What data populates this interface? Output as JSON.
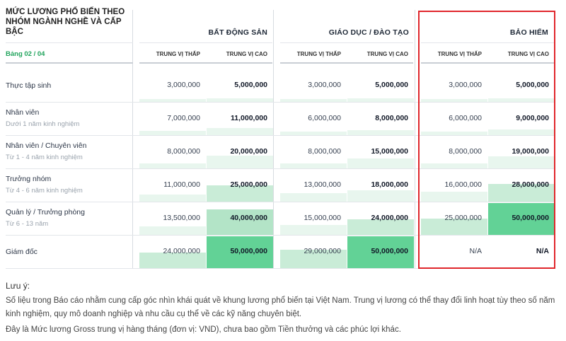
{
  "table": {
    "title": "MỨC LƯƠNG PHỔ BIẾN THEO NHÓM NGÀNH NGHỀ VÀ CẤP BẬC",
    "subtitle": "Bảng 02 / 04",
    "groups": [
      {
        "name": "BẤT ĐỘNG SẢN",
        "low_label": "TRUNG VỊ THẤP",
        "high_label": "TRUNG VỊ CAO"
      },
      {
        "name": "GIÁO DỤC / ĐÀO TẠO",
        "low_label": "TRUNG VỊ THẤP",
        "high_label": "TRUNG VỊ CAO"
      },
      {
        "name": "BẢO HIỂM",
        "low_label": "TRUNG VỊ THẤP",
        "high_label": "TRUNG VỊ CAO"
      }
    ],
    "rows": [
      {
        "label": "Thực tập sinh",
        "sub": "",
        "values": [
          "3,000,000",
          "5,000,000",
          "3,000,000",
          "5,000,000",
          "3,000,000",
          "5,000,000"
        ]
      },
      {
        "label": "Nhân viên",
        "sub": "Dưới 1 năm kinh nghiệm",
        "values": [
          "7,000,000",
          "11,000,000",
          "6,000,000",
          "8,000,000",
          "6,000,000",
          "9,000,000"
        ]
      },
      {
        "label": "Nhân viên / Chuyên viên",
        "sub": "Từ 1 - 4 năm kinh nghiệm",
        "values": [
          "8,000,000",
          "20,000,000",
          "8,000,000",
          "15,000,000",
          "8,000,000",
          "19,000,000"
        ]
      },
      {
        "label": "Trưởng nhóm",
        "sub": "Từ 4 - 6 năm kinh nghiệm",
        "values": [
          "11,000,000",
          "25,000,000",
          "13,000,000",
          "18,000,000",
          "16,000,000",
          "28,000,000"
        ]
      },
      {
        "label": "Quản lý / Trưởng phòng",
        "sub": "Từ 6 - 13 năm",
        "values": [
          "13,500,000",
          "40,000,000",
          "15,000,000",
          "24,000,000",
          "25,000,000",
          "50,000,000"
        ]
      },
      {
        "label": "Giám đốc",
        "sub": "",
        "values": [
          "24,000,000",
          "50,000,000",
          "29,000,000",
          "50,000,000",
          "N/A",
          "N/A"
        ]
      }
    ],
    "bar_levels": [
      [
        0.06,
        0.1,
        0.06,
        0.1,
        0.06,
        0.1
      ],
      [
        0.14,
        0.22,
        0.12,
        0.16,
        0.12,
        0.18
      ],
      [
        0.16,
        0.4,
        0.16,
        0.3,
        0.16,
        0.38
      ],
      [
        0.22,
        0.5,
        0.26,
        0.36,
        0.32,
        0.56
      ],
      [
        0.27,
        0.8,
        0.3,
        0.48,
        0.5,
        1.0
      ],
      [
        0.48,
        1.0,
        0.58,
        1.0,
        0,
        0
      ]
    ],
    "colors": {
      "bar_light": "#e8f6ee",
      "bar_mid": "#c9ecd7",
      "bar_strong": "#b3e4c7",
      "bar_full": "#62d296",
      "accent_green": "#22a45d",
      "highlight_red": "#e0262b"
    }
  },
  "notes": {
    "title": "Lưu ý:",
    "lines": [
      "Số liệu trong Báo cáo nhằm cung cấp góc nhìn khái quát về khung lương phổ biến tại Việt Nam. Trung vị lương có thể thay đổi linh hoạt tùy theo số năm kinh nghiệm, quy mô doanh nghiệp và nhu cầu cụ thể về các kỹ năng chuyên biệt.",
      "Đây là Mức lương Gross trung vị hàng tháng (đơn vị: VND), chưa bao gồm Tiền thưởng và các phúc lợi khác."
    ]
  }
}
